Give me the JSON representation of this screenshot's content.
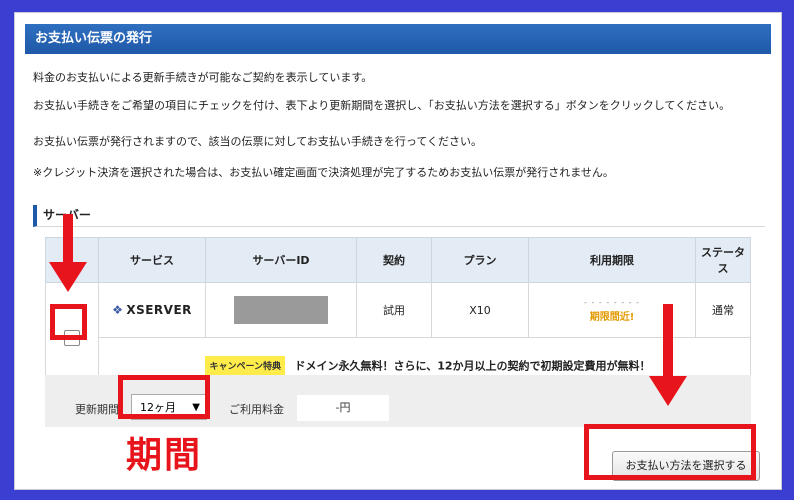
{
  "header": {
    "title": "お支払い伝票の発行"
  },
  "intro": {
    "line1": "料金のお支払いによる更新手続きが可能なご契約を表示しています。",
    "line2": "お支払い手続きをご希望の項目にチェックを付け、表下より更新期間を選択し、「お支払い方法を選択する」ボタンをクリックしてください。",
    "line3": "お支払い伝票が発行されますので、該当の伝票に対してお支払い手続きを行ってください。",
    "line4": "※クレジット決済を選択された場合は、お支払い確定画面で決済処理が完了するためお支払い伝票が発行されません。"
  },
  "section": {
    "title": "サーバー"
  },
  "table": {
    "columns": [
      "サービス",
      "サーバーID",
      "契約",
      "プラン",
      "利用期限",
      "ステータス"
    ],
    "row": {
      "service": "XSERVER",
      "contract": "試用",
      "plan": "X10",
      "expiry_warning": "期限間近!",
      "status": "通常"
    },
    "campaign": {
      "badge": "キャンペーン特典",
      "text": "ドメイン永久無料！さらに、12か月以上の契約で初期設定費用が無料！"
    }
  },
  "renewal": {
    "period_label": "更新期間",
    "period_value": "12ヶ月",
    "fee_label": "ご利用料金",
    "fee_value": "-円"
  },
  "action_button": "お支払い方法を選択する",
  "annotation": {
    "text": "期間"
  },
  "colors": {
    "highlight": "#e8141b",
    "header": "#1f59a8",
    "background": "#3b3fd1"
  }
}
